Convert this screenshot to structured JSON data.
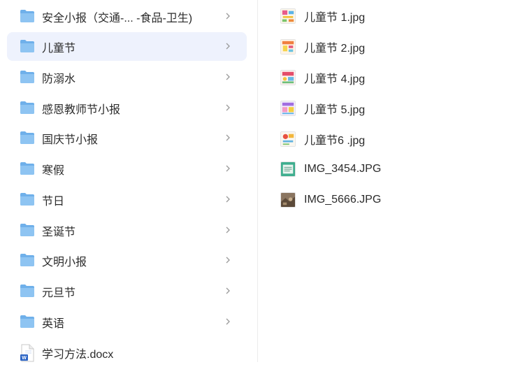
{
  "folders": [
    {
      "label": "安全小报（交通-... -食品-卫生)",
      "selected": false
    },
    {
      "label": "儿童节",
      "selected": true
    },
    {
      "label": "防溺水",
      "selected": false
    },
    {
      "label": "感恩教师节小报",
      "selected": false
    },
    {
      "label": "国庆节小报",
      "selected": false
    },
    {
      "label": "寒假",
      "selected": false
    },
    {
      "label": "节日",
      "selected": false
    },
    {
      "label": "圣诞节",
      "selected": false
    },
    {
      "label": "文明小报",
      "selected": false
    },
    {
      "label": "元旦节",
      "selected": false
    },
    {
      "label": "英语",
      "selected": false
    }
  ],
  "doc_file": {
    "label": "学习方法.docx",
    "icon": "word-doc-icon"
  },
  "files": [
    {
      "label": "儿童节 1.jpg",
      "thumb": "colorful-poster"
    },
    {
      "label": "儿童节 2.jpg",
      "thumb": "colorful-poster"
    },
    {
      "label": "儿童节 4.jpg",
      "thumb": "colorful-poster"
    },
    {
      "label": "儿童节 5.jpg",
      "thumb": "colorful-poster"
    },
    {
      "label": "儿童节6 .jpg",
      "thumb": "colorful-poster"
    },
    {
      "label": "IMG_3454.JPG",
      "thumb": "green-document"
    },
    {
      "label": "IMG_5666.JPG",
      "thumb": "brown-photo"
    }
  ],
  "colors": {
    "selected_bg": "#eef2fd",
    "folder_blue": "#8ec4f2",
    "folder_blue_dark": "#6fb0ea",
    "chevron": "#9a9a9a"
  }
}
